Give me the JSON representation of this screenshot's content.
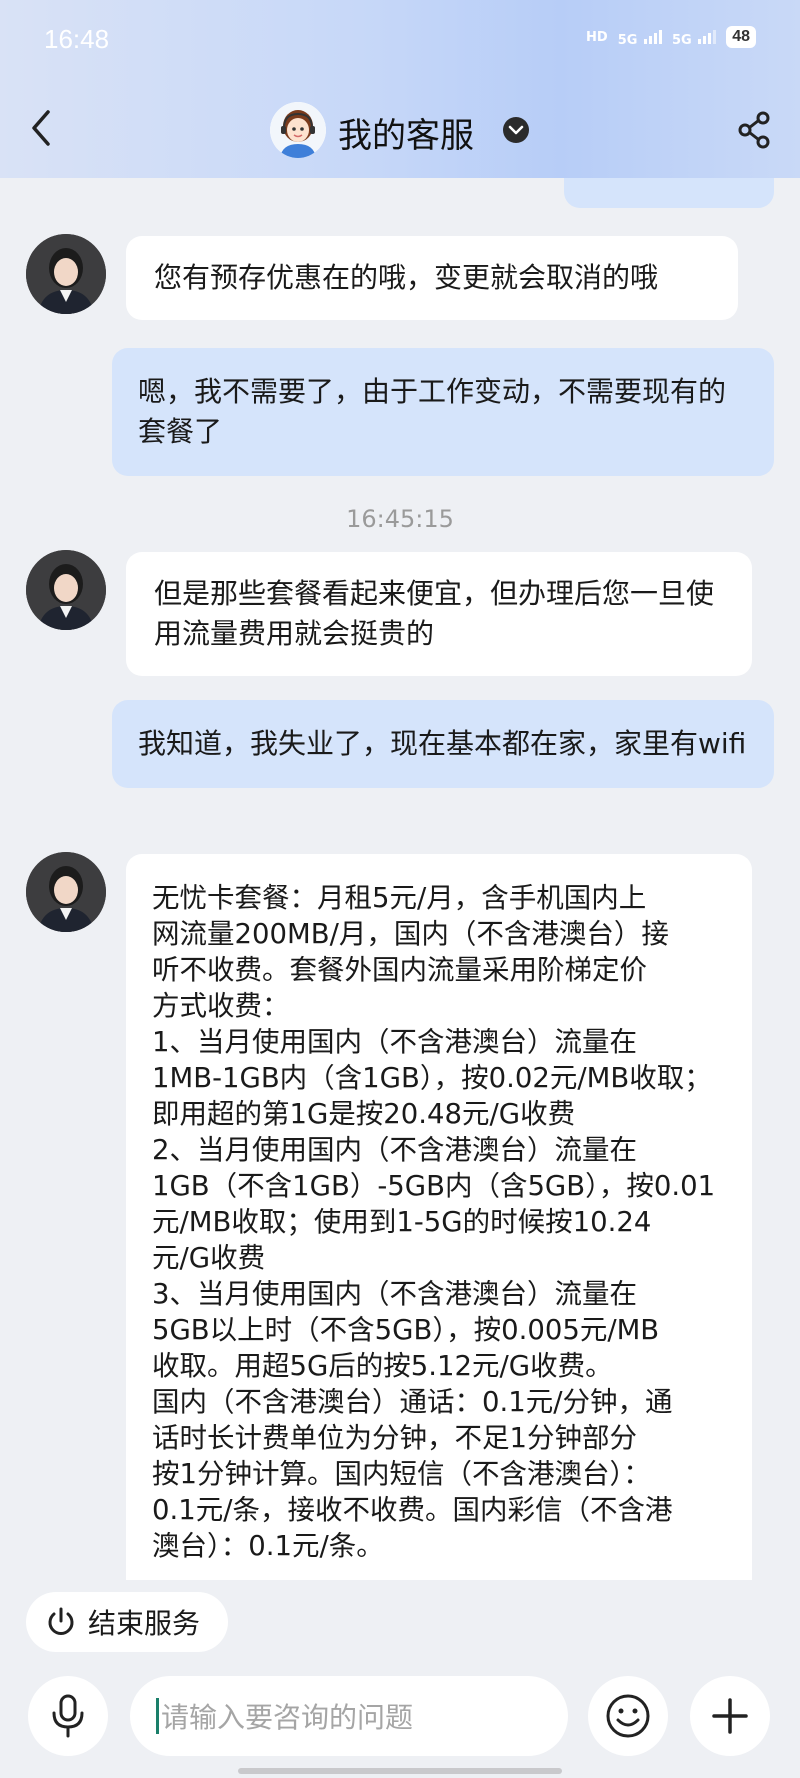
{
  "status_bar": {
    "time": "16:48",
    "hd_label": "HD",
    "network_1": "5G",
    "network_2": "5G",
    "battery": "48"
  },
  "header": {
    "title": "我的客服"
  },
  "messages": {
    "sent_1": "嗯，我不需要了，由于工作变动，不需要现有的套餐了",
    "recv_1": "您有预存优惠在的哦，变更就会取消的哦",
    "timestamp_1": "16:45:15",
    "recv_2": "但是那些套餐看起来便宜，但办理后您一旦使用流量费用就会挺贵的",
    "sent_2": "我知道，我失业了，现在基本都在家，家里有wifi",
    "recv_3_lines": [
      "无忧卡套餐：月租5元/月，含手机国内上",
      "网流量200MB/月，国内（不含港澳台）接",
      "听不收费。套餐外国内流量采用阶梯定价",
      "方式收费：",
      "1、当月使用国内（不含港澳台）流量在",
      "1MB-1GB内（含1GB），按0.02元/MB收取；",
      "即用超的第1G是按20.48元/G收费",
      "2、当月使用国内（不含港澳台）流量在",
      "1GB（不含1GB）-5GB内（含5GB），按0.01",
      "元/MB收取；使用到1-5G的时候按10.24",
      "元/G收费",
      "3、当月使用国内（不含港澳台）流量在",
      "5GB以上时（不含5GB），按0.005元/MB",
      "收取。用超5G后的按5.12元/G收费。",
      "国内（不含港澳台）通话：0.1元/分钟，通",
      "话时长计费单位为分钟，不足1分钟部分",
      "按1分钟计算。国内短信（不含港澳台）：",
      "0.1元/条，接收不收费。国内彩信（不含港",
      "澳台）：0.1元/条。"
    ]
  },
  "actions": {
    "end_service": "结束服务"
  },
  "input": {
    "placeholder": "请输入要咨询的问题"
  },
  "colors": {
    "sent_bubble": "#d5e4fb",
    "recv_bubble": "#ffffff",
    "background": "#eef0f4"
  }
}
